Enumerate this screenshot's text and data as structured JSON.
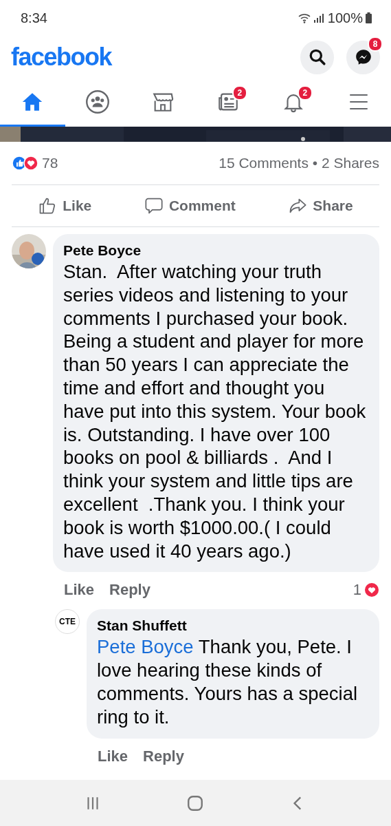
{
  "status_bar": {
    "time": "8:34",
    "battery": "100%"
  },
  "header": {
    "logo": "facebook",
    "messenger_badge": "8"
  },
  "tabs": [
    {
      "kind": "home",
      "selected": true
    },
    {
      "kind": "groups",
      "selected": false
    },
    {
      "kind": "marketplace",
      "selected": false
    },
    {
      "kind": "news",
      "selected": false,
      "badge": "2"
    },
    {
      "kind": "notifications",
      "selected": false,
      "badge": "2"
    },
    {
      "kind": "menu",
      "selected": false
    }
  ],
  "post": {
    "media": {
      "kind": "picture"
    },
    "reaction_count": "78",
    "comments_shares": "15 Comments • 2 Shares",
    "actions": [
      {
        "kind": "like",
        "label": "Like"
      },
      {
        "kind": "comment",
        "label": "Comment"
      },
      {
        "kind": "share",
        "label": "Share"
      }
    ]
  },
  "comments": [
    {
      "author": "Pete Boyce",
      "avatar": {
        "kind": "picture"
      },
      "text": "Stan.  After watching your truth series videos and listening to your comments I purchased your book. Being a student and player for more than 50 years I can appreciate the time and effort and thought you have put into this system. Your book is. Outstanding. I have over 100 books on pool & billiards .  And I think your system and little tips are excellent  .Thank you. I think your book is worth $1000.00.( I could have used it 40 years ago.)",
      "actions": [
        "Like",
        "Reply"
      ],
      "reaction_count": "1",
      "reply": false
    },
    {
      "author": "Stan Shuffett",
      "avatar": {
        "kind": "logo",
        "text": "CTE"
      },
      "mention": "Pete Boyce",
      "text": "Thank you, Pete. I love hearing these kinds of comments. Yours has a special ring to it.",
      "actions": [
        "Like",
        "Reply"
      ],
      "reply": true
    }
  ]
}
